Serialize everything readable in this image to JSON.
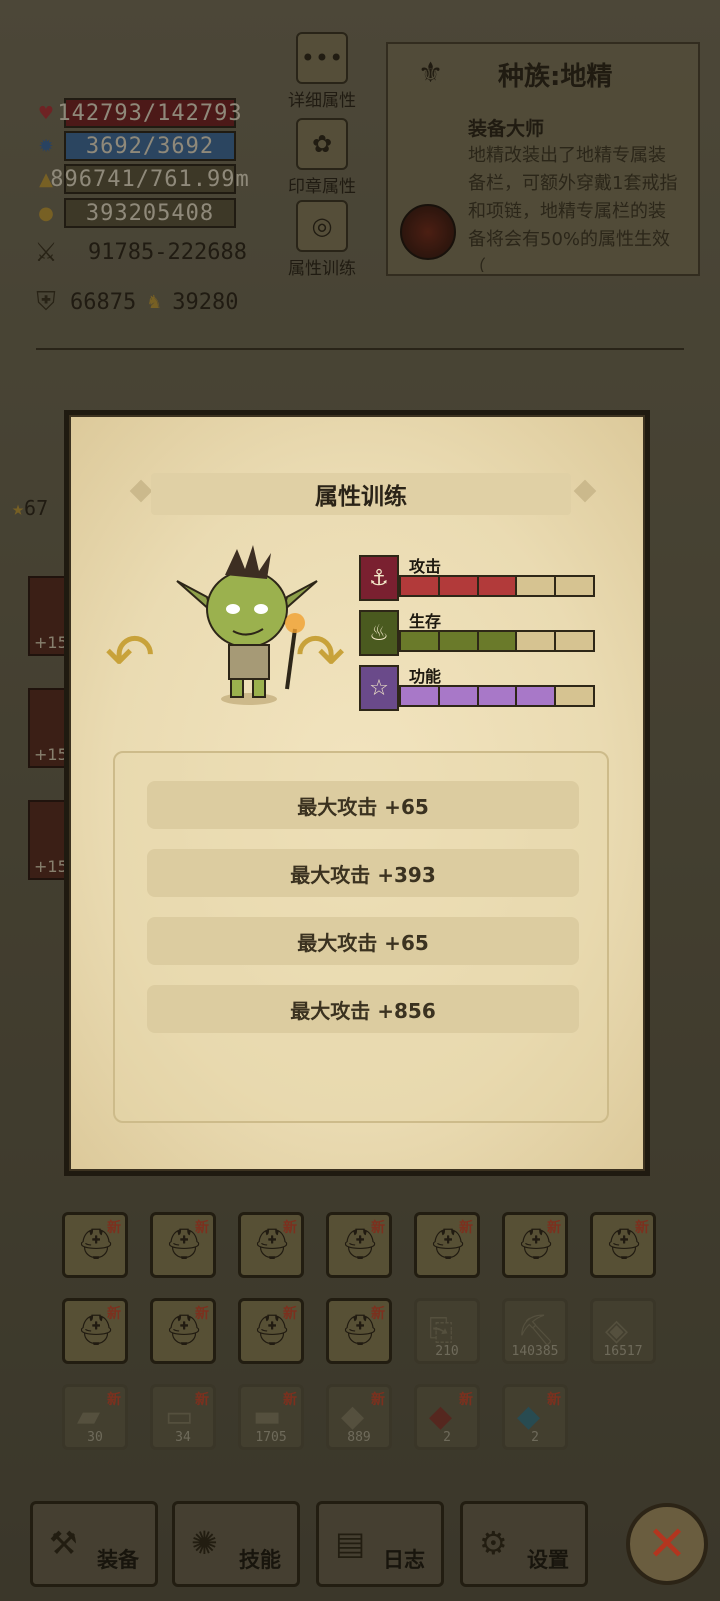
{
  "stats": {
    "hp": "142793/142793",
    "mp": "3692/3692",
    "exp": "896741/761.99m",
    "gold": "393205408",
    "attack": "91785-222688",
    "defense": "66875",
    "other": "39280",
    "star_partial": "67"
  },
  "side_buttons": {
    "detail": "详细属性",
    "seal": "印章属性",
    "training": "属性训练"
  },
  "race": {
    "title": "种族:地精",
    "subtitle": "装备大师",
    "description": "地精改装出了地精专属装备栏，可额外穿戴1套戒指和项链，地精专属栏的装备将会有50%的属性生效（"
  },
  "behind_cards": [
    "+15",
    "+15",
    "+15"
  ],
  "modal": {
    "title": "属性训练",
    "bars": [
      {
        "label": "攻击",
        "filled": 3,
        "total": 5,
        "color": "#b23a3a",
        "icon": "sword-icon"
      },
      {
        "label": "生存",
        "filled": 3,
        "total": 5,
        "color": "#6a7a2a",
        "icon": "leaf-icon"
      },
      {
        "label": "功能",
        "filled": 4,
        "total": 5,
        "color": "#a878c8",
        "icon": "star-icon"
      }
    ],
    "items": [
      "最大攻击  +65",
      "最大攻击  +393",
      "最大攻击  +65",
      "最大攻击  +856"
    ]
  },
  "inventory": {
    "new_label": "新",
    "row1": [
      "",
      "",
      "",
      "",
      "",
      "",
      ""
    ],
    "row2_counts": [
      "210",
      "140385",
      "16517"
    ],
    "row3_counts": [
      "30",
      "34",
      "1705",
      "889",
      "2",
      "2"
    ]
  },
  "nav": {
    "equip": "装备",
    "skill": "技能",
    "log": "日志",
    "settings": "设置"
  }
}
